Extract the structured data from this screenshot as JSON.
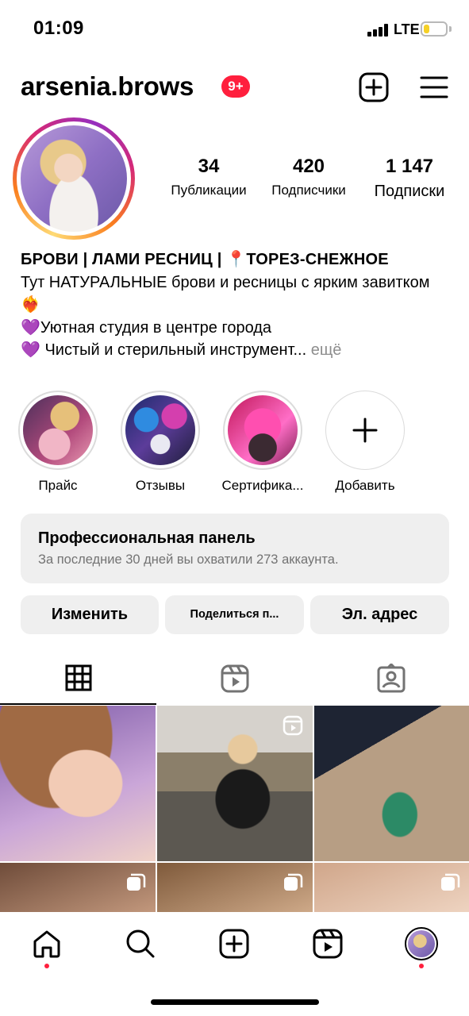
{
  "status_bar": {
    "time": "01:09",
    "network": "LTE",
    "battery_level": 0.25,
    "battery_color": "#f5d027"
  },
  "header": {
    "username": "arsenia.brows",
    "notification_badge": "9+",
    "icons": [
      "plus-square-icon",
      "hamburger-menu-icon"
    ]
  },
  "profile": {
    "stats": [
      {
        "value": "34",
        "label": "Публикации"
      },
      {
        "value": "420",
        "label": "Подписчики"
      },
      {
        "value": "1 147",
        "label": "Подписки"
      }
    ]
  },
  "bio": {
    "title": "БРОВИ | ЛАМИ РЕСНИЦ | 📍ТОРЕЗ-СНЕЖНОЕ",
    "line1": "Тут НАТУРАЛЬНЫЕ брови и ресницы с ярким завитком ❤️‍🔥",
    "line2": "💜Уютная студия в центре города",
    "line3": "💜 Чистый и стерильный инструмент...",
    "more": "ещё"
  },
  "highlights": [
    {
      "label": "Прайс"
    },
    {
      "label": "Отзывы"
    },
    {
      "label": "Сертифика..."
    },
    {
      "label": "Добавить"
    }
  ],
  "pro_panel": {
    "title": "Профессиональная панель",
    "subtitle": "За последние 30 дней вы охватили 273 аккаунта."
  },
  "actions": {
    "edit": "Изменить",
    "share": "Поделиться п...",
    "email": "Эл. адрес"
  },
  "tabs": [
    {
      "icon": "grid-icon",
      "active": true
    },
    {
      "icon": "reels-icon",
      "active": false
    },
    {
      "icon": "tagged-icon",
      "active": false
    }
  ],
  "posts": [
    {
      "badge": ""
    },
    {
      "badge": "reels-icon"
    },
    {
      "badge": ""
    },
    {
      "badge": "carousel-icon"
    },
    {
      "badge": "carousel-icon"
    },
    {
      "badge": "carousel-icon"
    }
  ],
  "bottom_nav": [
    "home-icon",
    "search-icon",
    "create-icon",
    "reels-icon",
    "profile-avatar"
  ],
  "colors": {
    "accent_red": "#ff1f3d",
    "panel_bg": "#efefef",
    "secondary_text": "#737373"
  }
}
